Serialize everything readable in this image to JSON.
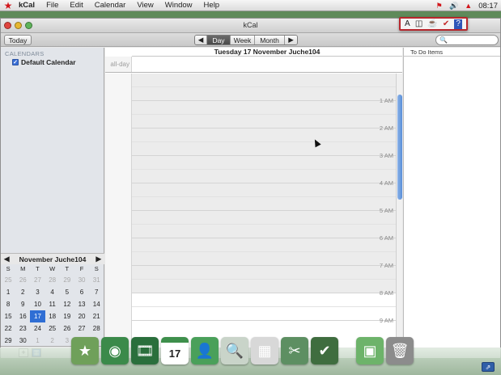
{
  "menubar": {
    "apple_icon": "star-icon",
    "app_name": "kCal",
    "items": [
      "File",
      "Edit",
      "Calendar",
      "View",
      "Window",
      "Help"
    ],
    "clock": "08:17",
    "tray_icons": [
      "flag-icon",
      "volume-icon",
      "flame-icon"
    ]
  },
  "window": {
    "title": "kCal",
    "toolbar": {
      "today_label": "Today",
      "views": [
        "Day",
        "Week",
        "Month"
      ],
      "active_view": "Day",
      "prev_icon": "◀",
      "next_icon": "▶",
      "search_icon": "🔍"
    }
  },
  "palette": {
    "icons": [
      {
        "name": "text-icon",
        "glyph": "A"
      },
      {
        "name": "columns-icon",
        "glyph": "◫"
      },
      {
        "name": "tea-icon",
        "glyph": "☕"
      },
      {
        "name": "check-icon",
        "glyph": "✔"
      },
      {
        "name": "help-icon",
        "glyph": "?"
      }
    ]
  },
  "sidebar": {
    "header": "CALENDARS",
    "calendars": [
      {
        "label": "Default Calendar",
        "checked": true
      }
    ],
    "mini_calendar": {
      "title": "November Juche104",
      "prev": "◀",
      "next": "▶",
      "weekdays": [
        "S",
        "M",
        "T",
        "W",
        "T",
        "F",
        "S"
      ],
      "weeks": [
        [
          {
            "d": "25",
            "o": true
          },
          {
            "d": "26",
            "o": true
          },
          {
            "d": "27",
            "o": true
          },
          {
            "d": "28",
            "o": true
          },
          {
            "d": "29",
            "o": true
          },
          {
            "d": "30",
            "o": true
          },
          {
            "d": "31",
            "o": true
          }
        ],
        [
          {
            "d": "1"
          },
          {
            "d": "2"
          },
          {
            "d": "3"
          },
          {
            "d": "4"
          },
          {
            "d": "5"
          },
          {
            "d": "6"
          },
          {
            "d": "7"
          }
        ],
        [
          {
            "d": "8"
          },
          {
            "d": "9"
          },
          {
            "d": "10"
          },
          {
            "d": "11"
          },
          {
            "d": "12"
          },
          {
            "d": "13"
          },
          {
            "d": "14"
          }
        ],
        [
          {
            "d": "15"
          },
          {
            "d": "16"
          },
          {
            "d": "17",
            "t": true
          },
          {
            "d": "18"
          },
          {
            "d": "19"
          },
          {
            "d": "20"
          },
          {
            "d": "21"
          }
        ],
        [
          {
            "d": "22"
          },
          {
            "d": "23"
          },
          {
            "d": "24"
          },
          {
            "d": "25"
          },
          {
            "d": "26"
          },
          {
            "d": "27"
          },
          {
            "d": "28"
          }
        ],
        [
          {
            "d": "29"
          },
          {
            "d": "30"
          },
          {
            "d": "1",
            "o": true
          },
          {
            "d": "2",
            "o": true
          },
          {
            "d": "3",
            "o": true
          },
          {
            "d": "4",
            "o": true
          },
          {
            "d": "5",
            "o": true
          }
        ]
      ]
    },
    "add_label": "+"
  },
  "day_view": {
    "date_title": "Tuesday 17 November Juche104",
    "all_day_label": "all-day",
    "hours": [
      "1 AM",
      "2 AM",
      "3 AM",
      "4 AM",
      "5 AM",
      "6 AM",
      "7 AM",
      "8 AM",
      "9 AM"
    ]
  },
  "todo": {
    "header": "To Do Items"
  },
  "dock": {
    "icons": [
      {
        "name": "finder-icon",
        "color": "#6fa05a",
        "glyph": "★"
      },
      {
        "name": "globe-icon",
        "color": "#3b8a4a",
        "glyph": "◉"
      },
      {
        "name": "film-icon",
        "color": "#2a6f3c",
        "glyph": "🎞"
      },
      {
        "name": "calendar-icon",
        "color": "#3e8f4c",
        "glyph": "17"
      },
      {
        "name": "address-book-icon",
        "color": "#4aa05a",
        "glyph": "👤"
      },
      {
        "name": "magnifier-icon",
        "color": "#c9d4c9",
        "glyph": "🔍"
      },
      {
        "name": "calculator-icon",
        "color": "#d8d8d8",
        "glyph": "▦"
      },
      {
        "name": "system-prefs-icon",
        "color": "#5d8f62",
        "glyph": "✂"
      },
      {
        "name": "image-icon",
        "color": "#3f6d3f",
        "glyph": "✔"
      },
      {
        "name": "folder-icon",
        "color": "#6db36a",
        "glyph": "▣"
      },
      {
        "name": "trash-icon",
        "color": "#8c8c8c",
        "glyph": "🗑"
      }
    ]
  }
}
